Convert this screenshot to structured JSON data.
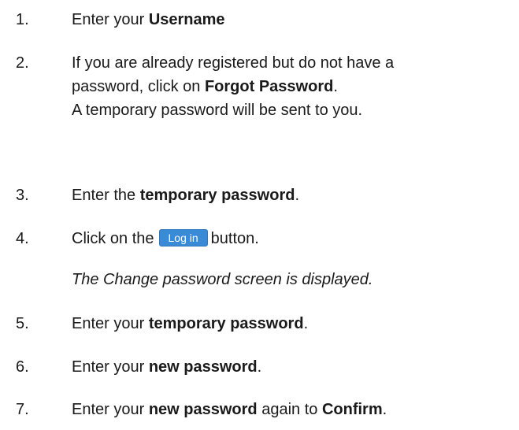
{
  "steps": [
    {
      "number": "1.",
      "lead": "Enter your ",
      "bold": "Username"
    },
    {
      "number": "2.",
      "line1": "If you are already registered but do not have a",
      "line2_lead": "password, click on ",
      "line2_bold": "Forgot Password",
      "line2_tail": ".",
      "line3": "A temporary password will be sent to you."
    },
    {
      "number": "3.",
      "lead": "Enter the ",
      "bold": "temporary password",
      "tail": "."
    },
    {
      "number": "4.",
      "lead": "Click on the",
      "button_label": "Log in",
      "tail": "button.",
      "note": "The Change password screen is displayed."
    },
    {
      "number": "5.",
      "lead": "Enter your ",
      "bold": "temporary password",
      "tail": "."
    },
    {
      "number": "6.",
      "lead": "Enter your ",
      "bold": "new password",
      "tail": "."
    },
    {
      "number": "7.",
      "lead": "Enter your ",
      "bold": "new password",
      "mid": " again to ",
      "bold2": "Confirm",
      "tail": "."
    }
  ]
}
